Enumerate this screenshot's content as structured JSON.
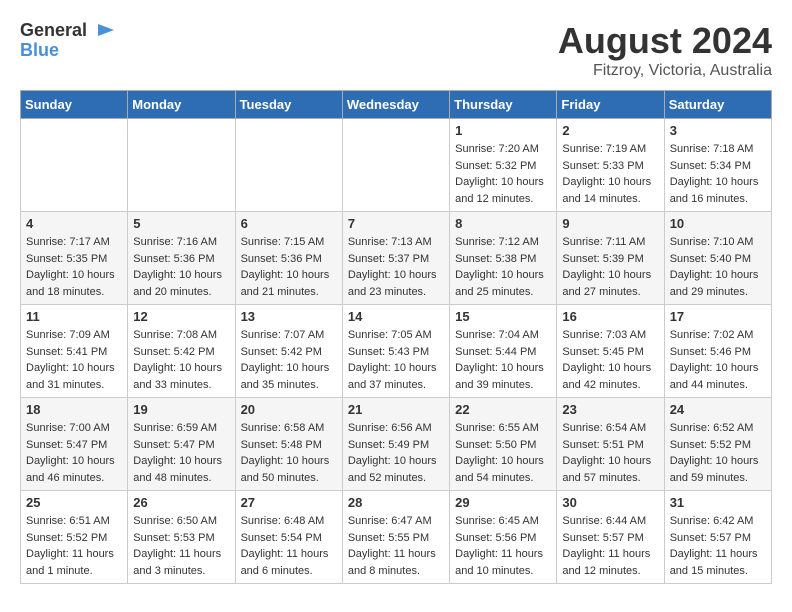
{
  "header": {
    "logo_general": "General",
    "logo_blue": "Blue",
    "month_year": "August 2024",
    "location": "Fitzroy, Victoria, Australia"
  },
  "days_of_week": [
    "Sunday",
    "Monday",
    "Tuesday",
    "Wednesday",
    "Thursday",
    "Friday",
    "Saturday"
  ],
  "weeks": [
    [
      {
        "day": "",
        "info": ""
      },
      {
        "day": "",
        "info": ""
      },
      {
        "day": "",
        "info": ""
      },
      {
        "day": "",
        "info": ""
      },
      {
        "day": "1",
        "info": "Sunrise: 7:20 AM\nSunset: 5:32 PM\nDaylight: 10 hours\nand 12 minutes."
      },
      {
        "day": "2",
        "info": "Sunrise: 7:19 AM\nSunset: 5:33 PM\nDaylight: 10 hours\nand 14 minutes."
      },
      {
        "day": "3",
        "info": "Sunrise: 7:18 AM\nSunset: 5:34 PM\nDaylight: 10 hours\nand 16 minutes."
      }
    ],
    [
      {
        "day": "4",
        "info": "Sunrise: 7:17 AM\nSunset: 5:35 PM\nDaylight: 10 hours\nand 18 minutes."
      },
      {
        "day": "5",
        "info": "Sunrise: 7:16 AM\nSunset: 5:36 PM\nDaylight: 10 hours\nand 20 minutes."
      },
      {
        "day": "6",
        "info": "Sunrise: 7:15 AM\nSunset: 5:36 PM\nDaylight: 10 hours\nand 21 minutes."
      },
      {
        "day": "7",
        "info": "Sunrise: 7:13 AM\nSunset: 5:37 PM\nDaylight: 10 hours\nand 23 minutes."
      },
      {
        "day": "8",
        "info": "Sunrise: 7:12 AM\nSunset: 5:38 PM\nDaylight: 10 hours\nand 25 minutes."
      },
      {
        "day": "9",
        "info": "Sunrise: 7:11 AM\nSunset: 5:39 PM\nDaylight: 10 hours\nand 27 minutes."
      },
      {
        "day": "10",
        "info": "Sunrise: 7:10 AM\nSunset: 5:40 PM\nDaylight: 10 hours\nand 29 minutes."
      }
    ],
    [
      {
        "day": "11",
        "info": "Sunrise: 7:09 AM\nSunset: 5:41 PM\nDaylight: 10 hours\nand 31 minutes."
      },
      {
        "day": "12",
        "info": "Sunrise: 7:08 AM\nSunset: 5:42 PM\nDaylight: 10 hours\nand 33 minutes."
      },
      {
        "day": "13",
        "info": "Sunrise: 7:07 AM\nSunset: 5:42 PM\nDaylight: 10 hours\nand 35 minutes."
      },
      {
        "day": "14",
        "info": "Sunrise: 7:05 AM\nSunset: 5:43 PM\nDaylight: 10 hours\nand 37 minutes."
      },
      {
        "day": "15",
        "info": "Sunrise: 7:04 AM\nSunset: 5:44 PM\nDaylight: 10 hours\nand 39 minutes."
      },
      {
        "day": "16",
        "info": "Sunrise: 7:03 AM\nSunset: 5:45 PM\nDaylight: 10 hours\nand 42 minutes."
      },
      {
        "day": "17",
        "info": "Sunrise: 7:02 AM\nSunset: 5:46 PM\nDaylight: 10 hours\nand 44 minutes."
      }
    ],
    [
      {
        "day": "18",
        "info": "Sunrise: 7:00 AM\nSunset: 5:47 PM\nDaylight: 10 hours\nand 46 minutes."
      },
      {
        "day": "19",
        "info": "Sunrise: 6:59 AM\nSunset: 5:47 PM\nDaylight: 10 hours\nand 48 minutes."
      },
      {
        "day": "20",
        "info": "Sunrise: 6:58 AM\nSunset: 5:48 PM\nDaylight: 10 hours\nand 50 minutes."
      },
      {
        "day": "21",
        "info": "Sunrise: 6:56 AM\nSunset: 5:49 PM\nDaylight: 10 hours\nand 52 minutes."
      },
      {
        "day": "22",
        "info": "Sunrise: 6:55 AM\nSunset: 5:50 PM\nDaylight: 10 hours\nand 54 minutes."
      },
      {
        "day": "23",
        "info": "Sunrise: 6:54 AM\nSunset: 5:51 PM\nDaylight: 10 hours\nand 57 minutes."
      },
      {
        "day": "24",
        "info": "Sunrise: 6:52 AM\nSunset: 5:52 PM\nDaylight: 10 hours\nand 59 minutes."
      }
    ],
    [
      {
        "day": "25",
        "info": "Sunrise: 6:51 AM\nSunset: 5:52 PM\nDaylight: 11 hours\nand 1 minute."
      },
      {
        "day": "26",
        "info": "Sunrise: 6:50 AM\nSunset: 5:53 PM\nDaylight: 11 hours\nand 3 minutes."
      },
      {
        "day": "27",
        "info": "Sunrise: 6:48 AM\nSunset: 5:54 PM\nDaylight: 11 hours\nand 6 minutes."
      },
      {
        "day": "28",
        "info": "Sunrise: 6:47 AM\nSunset: 5:55 PM\nDaylight: 11 hours\nand 8 minutes."
      },
      {
        "day": "29",
        "info": "Sunrise: 6:45 AM\nSunset: 5:56 PM\nDaylight: 11 hours\nand 10 minutes."
      },
      {
        "day": "30",
        "info": "Sunrise: 6:44 AM\nSunset: 5:57 PM\nDaylight: 11 hours\nand 12 minutes."
      },
      {
        "day": "31",
        "info": "Sunrise: 6:42 AM\nSunset: 5:57 PM\nDaylight: 11 hours\nand 15 minutes."
      }
    ]
  ]
}
